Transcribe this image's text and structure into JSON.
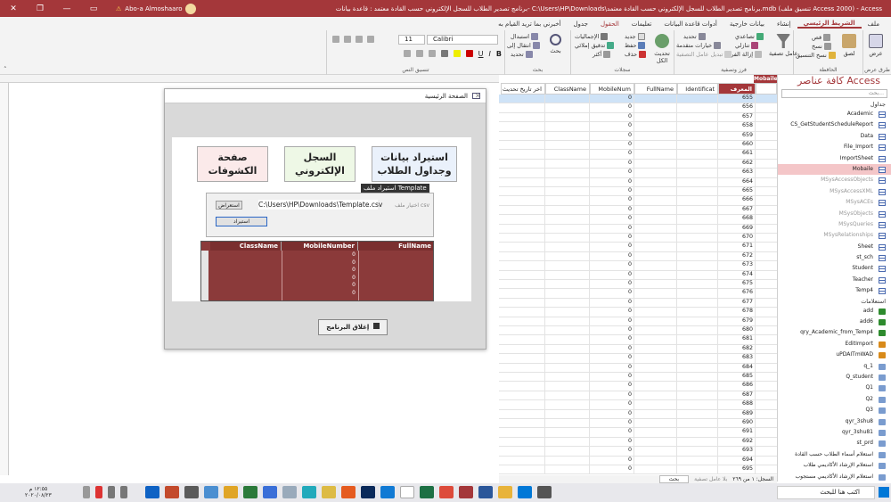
{
  "titlebar": {
    "title": "برنامج تصدير الطلاب للسجل الإلكتروني حسب القادة معتمد : قاعدة بيانات- C:\\Users\\HP\\Downloads\\برنامج تصدير الطلاب للسجل الإلكتروني حسب القادة معتمد.mdb (تنسيق ملف Access 2000) - Access",
    "user": "Abo-a Almoshaaro",
    "warning": "⚠"
  },
  "ribbon_tabs": [
    {
      "label": "ملف"
    },
    {
      "label": "الشريط الرئيسي",
      "active": true
    },
    {
      "label": "إنشاء"
    },
    {
      "label": "بيانات خارجية"
    },
    {
      "label": "أدوات قاعدة البيانات"
    },
    {
      "label": "تعليمات"
    },
    {
      "label": "الحقول",
      "ctx": true
    },
    {
      "label": "جدول"
    },
    {
      "label": "أخبرني بما تريد القيام به"
    }
  ],
  "ribbon": {
    "views": {
      "label": "عرض",
      "group": "طرق عرض"
    },
    "clipboard": {
      "paste": "لصق",
      "cut": "قص",
      "copy": "نسخ",
      "format_painter": "نسخ التنسيق",
      "group": "الحافظة"
    },
    "sort_filter": {
      "filter": "عامل تصفية",
      "ascending": "تصاعدي",
      "descending": "تنازلي",
      "remove_sort": "إزالة الفرز",
      "selection": "تحديد",
      "advanced": "خيارات متقدمة",
      "toggle": "تبديل عامل التصفية",
      "group": "فرز وتصفية"
    },
    "records": {
      "refresh": "تحديث الكل",
      "new": "جديد",
      "save": "حفظ",
      "delete": "حذف",
      "totals": "الإجماليات",
      "spelling": "تدقيق إملائي",
      "more": "أكثر",
      "group": "سجلات"
    },
    "find": {
      "find": "بحث",
      "replace": "استبدال",
      "goto": "انتقال إلى",
      "select": "تحديد",
      "group": "بحث"
    },
    "text_format": {
      "font": "Calibri",
      "size": "11",
      "group": "تنسيق النص"
    }
  },
  "navpane": {
    "title": "كافة عناصر Access",
    "search_placeholder": "بحث...",
    "tables_section": "جداول",
    "tables": [
      {
        "name": "Academic"
      },
      {
        "name": "CS_GetStudentScheduleReport"
      },
      {
        "name": "Data"
      },
      {
        "name": "File_Import"
      },
      {
        "name": "ImportSheet"
      },
      {
        "name": "Mobaile",
        "selected": true
      },
      {
        "name": "MSysAccessObjects",
        "system": true
      },
      {
        "name": "MSysAccessXML",
        "system": true
      },
      {
        "name": "MSysACEs",
        "system": true
      },
      {
        "name": "MSysObjects",
        "system": true
      },
      {
        "name": "MSysQueries",
        "system": true
      },
      {
        "name": "MSysRelationships",
        "system": true
      },
      {
        "name": "Sheet"
      },
      {
        "name": "st_sch"
      },
      {
        "name": "Student"
      },
      {
        "name": "Teacher"
      },
      {
        "name": "Temp4"
      }
    ],
    "queries_section": "استعلامات",
    "queries": [
      {
        "name": "add",
        "kind": "append"
      },
      {
        "name": "add6",
        "kind": "append"
      },
      {
        "name": "qry_Academic_from_Temp4",
        "kind": "append"
      },
      {
        "name": "EditImport",
        "kind": "update"
      },
      {
        "name": "uPDAITmWAD",
        "kind": "update"
      },
      {
        "name": "q_1",
        "kind": "select"
      },
      {
        "name": "Q_student",
        "kind": "select"
      },
      {
        "name": "Q1",
        "kind": "select"
      },
      {
        "name": "Q2",
        "kind": "select"
      },
      {
        "name": "Q3",
        "kind": "select"
      },
      {
        "name": "qyr_3shu8",
        "kind": "select"
      },
      {
        "name": "qyr_3shu81",
        "kind": "select"
      },
      {
        "name": "st_prd",
        "kind": "select"
      },
      {
        "name": "استعلام أسماء الطلاب حسب القادة",
        "kind": "select"
      },
      {
        "name": "استعلام الإرشاد الأكاديمي طلاب",
        "kind": "select"
      },
      {
        "name": "استعلام الإرشاد الأكاديمي مستجوب",
        "kind": "select"
      }
    ]
  },
  "datasheet": {
    "tab_label": "Mobaile",
    "headers": [
      "المعرف",
      "Identificat",
      "FullName",
      "MobileNum",
      "ClassName",
      "اخر تاريخ تحديث"
    ],
    "ids": [
      655,
      656,
      657,
      658,
      659,
      660,
      661,
      662,
      663,
      664,
      665,
      666,
      667,
      668,
      669,
      670,
      671,
      672,
      673,
      674,
      675,
      676,
      677,
      678,
      679,
      680,
      681,
      682,
      683,
      684,
      685,
      686,
      687,
      688,
      689,
      690,
      691,
      692,
      693,
      694,
      695
    ],
    "mobile_values": [
      "0",
      "0",
      "0",
      "0",
      "0",
      "0",
      "0",
      "0",
      "0",
      "0",
      "0",
      "0",
      "0",
      "0",
      "0",
      "0",
      "0",
      "0",
      "0",
      "0",
      "0",
      "0",
      "0",
      "0",
      "0",
      "0",
      "0",
      "0",
      "0",
      "0",
      "0",
      "0",
      "0",
      "0",
      "0",
      "0",
      "0",
      "0",
      "0",
      "0",
      "0"
    ],
    "record_nav": {
      "record": "السجل: ١ من ٢٦٩",
      "filter": "بلا عامل تصفية",
      "search": "بحث"
    }
  },
  "form": {
    "title": "الصفحة الرئيسية",
    "tiles": [
      {
        "label": "استيراد بيانات وجداول الطلاب",
        "color": "#1f3a93"
      },
      {
        "label": "السجل الإلكتروني",
        "color": "#2e8b2e"
      },
      {
        "label": "صفحة الكشوفات",
        "color": "#c0161d"
      }
    ],
    "tooltip": "استيراد ملف Template",
    "import": {
      "label": "اختيار ملف csv",
      "path": "C:\\Users\\HP\\Downloads\\Template.csv",
      "browse": "استعراض",
      "import_button": "استيراد"
    },
    "subgrid": {
      "headers": [
        "FullName",
        "MobileNumber",
        "ClassName"
      ],
      "mobile_values": [
        "0",
        "0",
        "0",
        "0",
        "0",
        "0"
      ]
    },
    "exit_button": "إغلاق البرنامج"
  },
  "taskbar": {
    "search_placeholder": "اكتب هنا للبحث",
    "time": "١٢:٥٥ م",
    "date": "٢٠٢٠/٠٨/٢٣"
  },
  "colors": {
    "accent": "#a4373a",
    "tile_border": "#aaaaaa",
    "subgrid": "#8b3a3a"
  }
}
